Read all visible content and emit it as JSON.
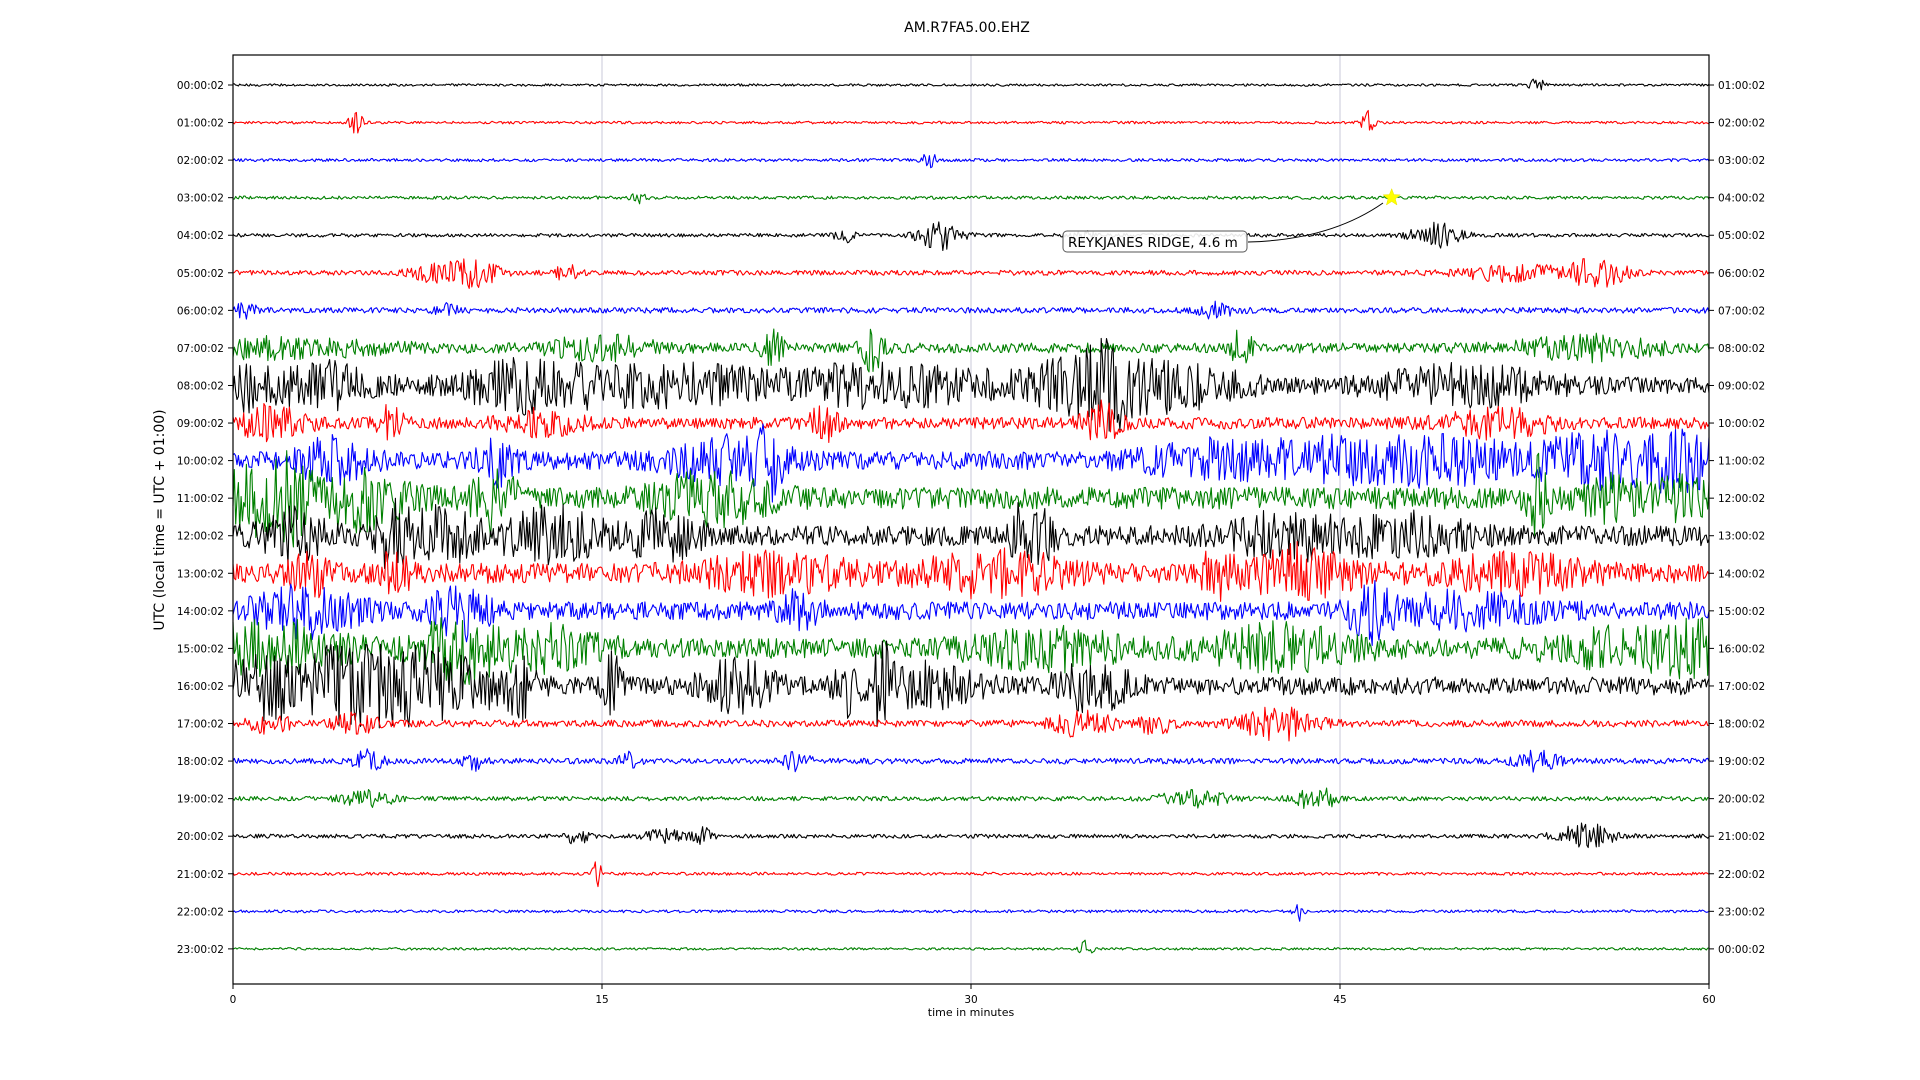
{
  "chart_data": {
    "type": "line",
    "title": "AM.R7FA5.00.EHZ",
    "xlabel": "time in minutes",
    "ylabel": "UTC (local time = UTC + 01:00)",
    "xlim": [
      0,
      60
    ],
    "x_ticks": [
      0,
      15,
      30,
      45,
      60
    ],
    "x_tick_labels": [
      "0",
      "15",
      "30",
      "45",
      "60"
    ],
    "grid": "vertical lines at 15, 30, 45",
    "left_labels": [
      "00:00:02",
      "01:00:02",
      "02:00:02",
      "03:00:02",
      "04:00:02",
      "05:00:02",
      "06:00:02",
      "07:00:02",
      "08:00:02",
      "09:00:02",
      "10:00:02",
      "11:00:02",
      "12:00:02",
      "13:00:02",
      "14:00:02",
      "15:00:02",
      "16:00:02",
      "17:00:02",
      "18:00:02",
      "19:00:02",
      "20:00:02",
      "21:00:02",
      "22:00:02",
      "23:00:02"
    ],
    "right_labels": [
      "01:00:02",
      "02:00:02",
      "03:00:02",
      "04:00:02",
      "05:00:02",
      "06:00:02",
      "07:00:02",
      "08:00:02",
      "09:00:02",
      "10:00:02",
      "11:00:02",
      "12:00:02",
      "13:00:02",
      "14:00:02",
      "15:00:02",
      "16:00:02",
      "17:00:02",
      "18:00:02",
      "19:00:02",
      "20:00:02",
      "21:00:02",
      "22:00:02",
      "23:00:02",
      "00:00:02"
    ],
    "trace_colors": [
      "#000000",
      "#ff0000",
      "#0000ff",
      "#008000"
    ],
    "trace_noise_level": [
      1.2,
      1.3,
      1.5,
      1.6,
      1.8,
      2.5,
      2.8,
      5,
      8,
      6,
      9,
      11,
      10,
      10,
      9,
      10,
      9,
      3.5,
      2.8,
      2.2,
      2,
      1.5,
      1.4,
      1.2
    ],
    "traces_bursts": [
      [
        [
          53.0,
          8,
          0.2
        ]
      ],
      [
        [
          5.0,
          10,
          0.2
        ],
        [
          46.1,
          12,
          0.2
        ]
      ],
      [
        [
          28.3,
          8,
          0.2
        ]
      ],
      [
        [
          16.5,
          6,
          0.2
        ]
      ],
      [
        [
          24.8,
          7,
          0.3
        ],
        [
          28.7,
          14,
          0.6
        ],
        [
          34.5,
          6,
          0.3
        ],
        [
          48.9,
          12,
          0.7
        ]
      ],
      [
        [
          8.5,
          10,
          0.8
        ],
        [
          10.0,
          12,
          0.6
        ],
        [
          13.6,
          10,
          0.3
        ],
        [
          52.0,
          8,
          1.5
        ],
        [
          55.5,
          14,
          0.8
        ]
      ],
      [
        [
          0.5,
          6,
          0.4
        ],
        [
          8.7,
          6,
          0.3
        ],
        [
          40.0,
          8,
          0.5
        ]
      ],
      [
        [
          2.0,
          8,
          3.0
        ],
        [
          15.0,
          10,
          1.5
        ],
        [
          21.9,
          18,
          0.3
        ],
        [
          26.0,
          22,
          0.3
        ],
        [
          41.0,
          16,
          0.3
        ],
        [
          55.0,
          10,
          2.0
        ]
      ],
      [
        [
          0.7,
          20,
          0.5
        ],
        [
          3.5,
          20,
          1.5
        ],
        [
          12.0,
          20,
          2.0
        ],
        [
          18.0,
          16,
          3.0
        ],
        [
          26.5,
          18,
          2.5
        ],
        [
          34.0,
          20,
          2.0
        ],
        [
          35.5,
          24,
          0.5
        ],
        [
          38.0,
          20,
          2.0
        ],
        [
          50.0,
          16,
          2.5
        ]
      ],
      [
        [
          1.5,
          14,
          1.0
        ],
        [
          6.4,
          22,
          0.3
        ],
        [
          12.5,
          12,
          1.0
        ],
        [
          24.0,
          16,
          0.4
        ],
        [
          35.3,
          18,
          0.5
        ],
        [
          51.5,
          12,
          1.5
        ]
      ],
      [
        [
          4.0,
          18,
          1.0
        ],
        [
          10.7,
          20,
          0.5
        ],
        [
          20.0,
          18,
          1.5
        ],
        [
          21.8,
          30,
          0.4
        ],
        [
          40.0,
          16,
          2.0
        ],
        [
          44.5,
          16,
          1.5
        ],
        [
          49.0,
          20,
          2.0
        ],
        [
          55.5,
          22,
          2.0
        ],
        [
          59.0,
          22,
          1.0
        ]
      ],
      [
        [
          0.5,
          26,
          1.0
        ],
        [
          2.1,
          34,
          0.6
        ],
        [
          5.0,
          24,
          1.5
        ],
        [
          10.6,
          30,
          0.6
        ],
        [
          19.5,
          22,
          1.5
        ],
        [
          53.1,
          34,
          0.3
        ],
        [
          56.0,
          16,
          1.0
        ],
        [
          59.0,
          14,
          1.0
        ]
      ],
      [
        [
          2.5,
          20,
          1.0
        ],
        [
          6.5,
          28,
          0.5
        ],
        [
          8.5,
          22,
          1.0
        ],
        [
          13.0,
          22,
          1.5
        ],
        [
          17.5,
          20,
          1.0
        ],
        [
          32.0,
          24,
          0.4
        ],
        [
          33.0,
          18,
          0.4
        ],
        [
          43.0,
          18,
          2.0
        ],
        [
          48.0,
          16,
          1.5
        ]
      ],
      [
        [
          3.2,
          18,
          0.6
        ],
        [
          6.6,
          20,
          0.4
        ],
        [
          22.0,
          16,
          2.0
        ],
        [
          31.0,
          18,
          2.0
        ],
        [
          40.0,
          18,
          0.5
        ],
        [
          43.5,
          22,
          1.5
        ],
        [
          52.0,
          14,
          2.0
        ]
      ],
      [
        [
          3.0,
          20,
          1.5
        ],
        [
          9.2,
          24,
          0.8
        ],
        [
          23.0,
          18,
          0.5
        ],
        [
          46.2,
          24,
          0.6
        ],
        [
          50.0,
          14,
          2.0
        ]
      ],
      [
        [
          1.5,
          24,
          2.0
        ],
        [
          9.0,
          22,
          1.0
        ],
        [
          12.0,
          18,
          2.0
        ],
        [
          33.0,
          16,
          2.0
        ],
        [
          42.5,
          18,
          2.0
        ],
        [
          56.5,
          16,
          2.0
        ],
        [
          59.5,
          18,
          1.0
        ]
      ],
      [
        [
          2.0,
          26,
          2.5
        ],
        [
          6.0,
          24,
          2.0
        ],
        [
          9.0,
          20,
          1.5
        ],
        [
          11.7,
          26,
          0.4
        ],
        [
          15.4,
          28,
          0.3
        ],
        [
          20.5,
          24,
          1.0
        ],
        [
          24.9,
          26,
          0.3
        ],
        [
          26.4,
          30,
          0.3
        ],
        [
          28.0,
          18,
          1.5
        ],
        [
          35.0,
          20,
          1.0
        ]
      ],
      [
        [
          1.5,
          8,
          0.6
        ],
        [
          5.0,
          10,
          0.6
        ],
        [
          34.5,
          14,
          0.8
        ],
        [
          37.5,
          10,
          0.5
        ],
        [
          42.5,
          16,
          1.0
        ]
      ],
      [
        [
          5.5,
          10,
          0.4
        ],
        [
          9.8,
          8,
          0.3
        ],
        [
          16.0,
          8,
          0.3
        ],
        [
          23.0,
          10,
          0.4
        ],
        [
          53.0,
          10,
          0.6
        ]
      ],
      [
        [
          5.5,
          8,
          0.8
        ],
        [
          39.0,
          8,
          1.0
        ],
        [
          43.5,
          8,
          0.4
        ],
        [
          44.5,
          8,
          0.3
        ]
      ],
      [
        [
          14.0,
          8,
          0.3
        ],
        [
          17.5,
          6,
          0.6
        ],
        [
          19.1,
          8,
          0.3
        ],
        [
          55.0,
          12,
          0.8
        ]
      ],
      [
        [
          14.8,
          12,
          0.15
        ]
      ],
      [
        [
          43.3,
          10,
          0.15
        ]
      ],
      [
        [
          34.7,
          8,
          0.2
        ]
      ]
    ],
    "annotation": {
      "text": "REYKJANES RIDGE, 4.6 m",
      "trace_row": 3,
      "time_min": 47.1,
      "marker": "star",
      "marker_color": "#ffff00"
    }
  }
}
